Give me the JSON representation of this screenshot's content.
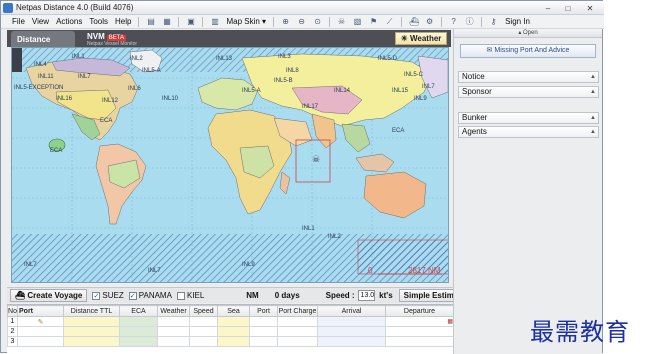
{
  "window": {
    "title": "Netpas Distance 4.0 (Build 4076)",
    "min": "–",
    "max": "□",
    "close": "✕"
  },
  "menu": {
    "file": "File",
    "view": "View",
    "actions": "Actions",
    "tools": "Tools",
    "help": "Help",
    "map_skin": "Map Skin",
    "sign_in": "Sign In"
  },
  "tabs": {
    "distance": "Distance",
    "nvm": "NVM",
    "nvm_badge": "BETA",
    "nvm_sub": "Netpas Vessel Monitor",
    "weather": "Weather"
  },
  "map": {
    "labels": [
      {
        "text": "INL1"
      },
      {
        "text": "INL2"
      },
      {
        "text": "INL3"
      },
      {
        "text": "INL4"
      },
      {
        "text": "INL5-A"
      },
      {
        "text": "INL5-B"
      },
      {
        "text": "INL5-D"
      },
      {
        "text": "INL5-C"
      },
      {
        "text": "INL6"
      },
      {
        "text": "INL7"
      },
      {
        "text": "INL8"
      },
      {
        "text": "INL9"
      },
      {
        "text": "INL10"
      },
      {
        "text": "INL11"
      },
      {
        "text": "INL12"
      },
      {
        "text": "INL13"
      },
      {
        "text": "INL14"
      },
      {
        "text": "INL15"
      },
      {
        "text": "INL16"
      },
      {
        "text": "ECA"
      },
      {
        "text": "ECA"
      },
      {
        "text": "ECA"
      },
      {
        "text": "INL17"
      },
      {
        "text": "INL5-EXCEPTION"
      },
      {
        "text": "INL7"
      },
      {
        "text": "INL1"
      },
      {
        "text": "INL7"
      },
      {
        "text": "INL9"
      },
      {
        "text": "INL2"
      },
      {
        "text": "INL5-A"
      },
      {
        "text": "INL7"
      }
    ],
    "scale_zero": "0",
    "scale_value": "2817 NM"
  },
  "controls": {
    "create_voyage": "Create Voyage",
    "suez": "SUEZ",
    "panama": "PANAMA",
    "kiel": "KIEL",
    "suez_checked": true,
    "panama_checked": true,
    "kiel_checked": false,
    "nm": "NM",
    "days": "0 days",
    "speed_label": "Speed :",
    "speed_value": "13.0",
    "speed_unit": "kt's",
    "simple_estimation": "Simple Estimation"
  },
  "table": {
    "headers": [
      "No",
      "Port",
      "Distance TTL",
      "ECA",
      "Weather",
      "Speed",
      "Sea",
      "Port",
      "Port Charge",
      "Arrival",
      "Departure"
    ],
    "rows": [
      {
        "no": "1"
      },
      {
        "no": "2"
      },
      {
        "no": "3"
      }
    ]
  },
  "panel": {
    "open": "Open",
    "missing_port": "Missing Port And Advice",
    "notice": "Notice",
    "sponsor": "Sponsor",
    "bunker": "Bunker",
    "agents": "Agents"
  },
  "watermark": "最需教育",
  "colors": {
    "sea": "#a9dcef",
    "eca_zone": "#4b6fb0",
    "tab_bar": "#4d4f54",
    "watermark": "#1c2fa3"
  }
}
